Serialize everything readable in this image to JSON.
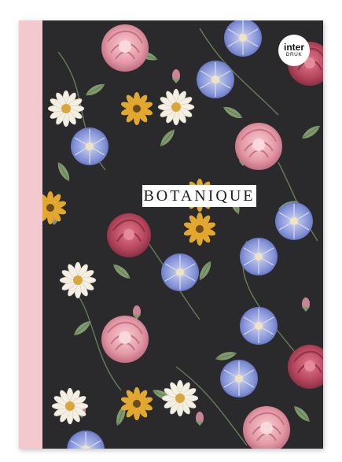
{
  "cover": {
    "title": "BOTANIQUE",
    "brand_top": "inter",
    "brand_bottom": "DRUK"
  },
  "colors": {
    "background": "#2a2a2c",
    "spine": "#f3c9cf",
    "rose": "#e8a4b0",
    "dark_rose": "#b8475f",
    "morning_glory": "#7f8fd6",
    "daisy_yellow": "#e2a72e",
    "leaf": "#7f9a6c"
  }
}
